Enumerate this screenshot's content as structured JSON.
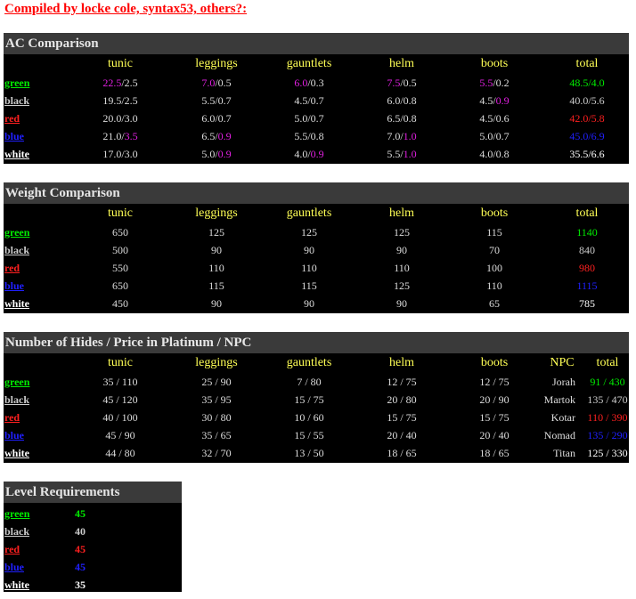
{
  "credit": "Compiled by locke cole, syntax53, others?:",
  "colors": {
    "green": "#00ee00",
    "black": "#cccccc",
    "red": "#ff2020",
    "blue": "#2020ff",
    "white": "#ffffff",
    "magenta": "#e020e0",
    "header_text": "#ffff55"
  },
  "ac": {
    "title": "AC Comparison",
    "headers": [
      "tunic",
      "leggings",
      "gauntlets",
      "helm",
      "boots",
      "total"
    ],
    "rows": [
      {
        "label": "green",
        "color": "green",
        "cells": [
          [
            "22.5",
            "/2.5"
          ],
          [
            "7.0",
            "/0.5"
          ],
          [
            "6.0",
            "/0.3"
          ],
          [
            "7.5",
            "/0.5"
          ],
          [
            "5.5",
            "/0.2"
          ],
          [
            "48.5/4.0"
          ]
        ]
      },
      {
        "label": "black",
        "color": "black",
        "cells": [
          [
            "19.5/2.5"
          ],
          [
            "5.5/0.7"
          ],
          [
            "4.5/0.7"
          ],
          [
            "6.0/0.8"
          ],
          [
            "4.5/",
            "0.9"
          ],
          [
            "40.0/5.6"
          ]
        ]
      },
      {
        "label": "red",
        "color": "red",
        "cells": [
          [
            "20.0/3.0"
          ],
          [
            "6.0/0.7"
          ],
          [
            "5.0/0.7"
          ],
          [
            "6.5/0.8"
          ],
          [
            "4.5/0.6"
          ],
          [
            "42.0/5.8"
          ]
        ]
      },
      {
        "label": "blue",
        "color": "blue",
        "cells": [
          [
            "21.0/",
            "3.5"
          ],
          [
            "6.5/",
            "0.9"
          ],
          [
            "5.5/0.8"
          ],
          [
            "7.0/",
            "1.0"
          ],
          [
            "5.0/0.7"
          ],
          [
            "45.0/6.9"
          ]
        ]
      },
      {
        "label": "white",
        "color": "white",
        "cells": [
          [
            "17.0/3.0"
          ],
          [
            "5.0/",
            "0.9"
          ],
          [
            "4.0/",
            "0.9"
          ],
          [
            "5.5/",
            "1.0"
          ],
          [
            "4.0/0.8"
          ],
          [
            "35.5/6.6"
          ]
        ]
      }
    ]
  },
  "weight": {
    "title": "Weight Comparison",
    "headers": [
      "tunic",
      "leggings",
      "gauntlets",
      "helm",
      "boots",
      "total"
    ],
    "rows": [
      {
        "label": "green",
        "color": "green",
        "cells": [
          "650",
          "125",
          "125",
          "125",
          "115",
          "1140"
        ]
      },
      {
        "label": "black",
        "color": "black",
        "cells": [
          "500",
          "90",
          "90",
          "90",
          "70",
          "840"
        ]
      },
      {
        "label": "red",
        "color": "red",
        "cells": [
          "550",
          "110",
          "110",
          "110",
          "100",
          "980"
        ]
      },
      {
        "label": "blue",
        "color": "blue",
        "cells": [
          "650",
          "115",
          "115",
          "125",
          "110",
          "1115"
        ]
      },
      {
        "label": "white",
        "color": "white",
        "cells": [
          "450",
          "90",
          "90",
          "90",
          "65",
          "785"
        ]
      }
    ]
  },
  "hides": {
    "title": "Number of Hides / Price in Platinum / NPC",
    "headers": [
      "tunic",
      "leggings",
      "gauntlets",
      "helm",
      "boots",
      "NPC",
      "total"
    ],
    "rows": [
      {
        "label": "green",
        "color": "green",
        "cells": [
          "35 / 110",
          "25 / 90",
          "7 / 80",
          "12 / 75",
          "12 / 75"
        ],
        "npc": "Jorah",
        "total": "91 / 430"
      },
      {
        "label": "black",
        "color": "black",
        "cells": [
          "45 / 120",
          "35 / 95",
          "15 / 75",
          "20 / 80",
          "20 / 90"
        ],
        "npc": "Martok",
        "total": "135 / 470"
      },
      {
        "label": "red",
        "color": "red",
        "cells": [
          "40 / 100",
          "30 / 80",
          "10 / 60",
          "15 / 75",
          "15 / 75"
        ],
        "npc": "Kotar",
        "total": "110 / 390"
      },
      {
        "label": "blue",
        "color": "blue",
        "cells": [
          "45 / 90",
          "35 / 65",
          "15 / 55",
          "20 / 40",
          "20 / 40"
        ],
        "npc": "Nomad",
        "total": "135 / 290"
      },
      {
        "label": "white",
        "color": "white",
        "cells": [
          "44 / 80",
          "32 / 70",
          "13 / 50",
          "18 / 65",
          "18 / 65"
        ],
        "npc": "Titan",
        "total": "125 / 330"
      }
    ]
  },
  "level": {
    "title": "Level Requirements",
    "rows": [
      {
        "label": "green",
        "color": "green",
        "value": "45"
      },
      {
        "label": "black",
        "color": "black",
        "value": "40"
      },
      {
        "label": "red",
        "color": "red",
        "value": "45"
      },
      {
        "label": "blue",
        "color": "blue",
        "value": "45"
      },
      {
        "label": "white",
        "color": "white",
        "value": "35"
      }
    ]
  }
}
